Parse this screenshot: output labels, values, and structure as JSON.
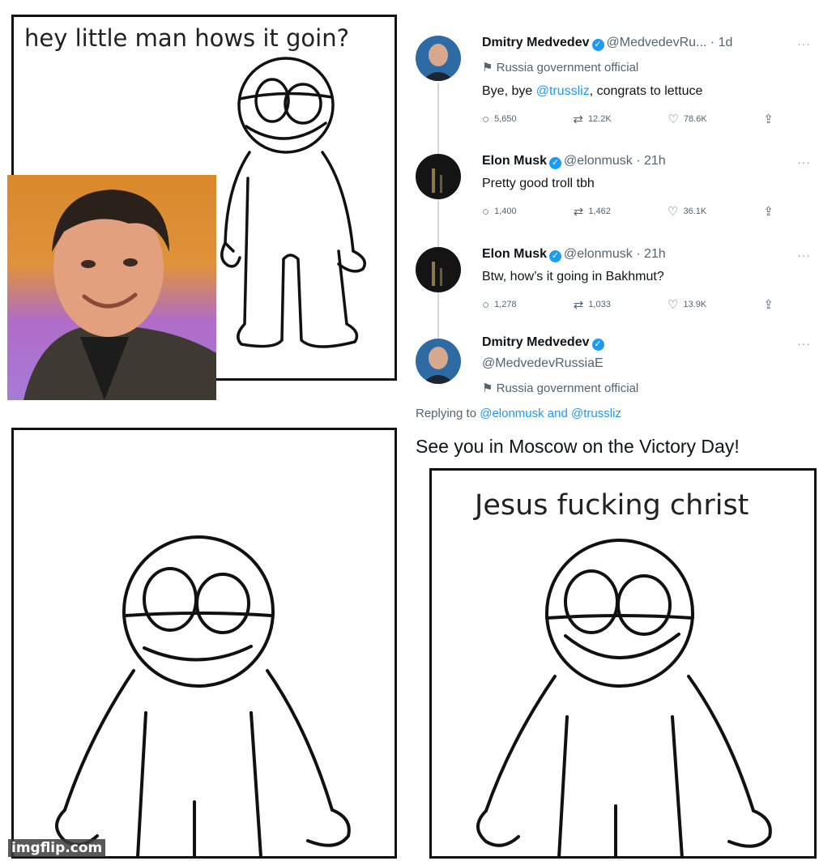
{
  "panels": {
    "top_left_caption": "hey little man hows it goin?",
    "bottom_right_caption": "Jesus fucking christ"
  },
  "tweets": [
    {
      "name": "Dmitry Medvedev",
      "handle": "@MedvedevRu...",
      "time": "· 1d",
      "gov_label": "Russia government official",
      "text_before": "Bye, bye ",
      "mention": "@trussliz",
      "text_after": ", congrats to lettuce",
      "replies": "5,650",
      "retweets": "12.2K",
      "likes": "78.6K"
    },
    {
      "name": "Elon Musk",
      "handle": "@elonmusk",
      "time": "· 21h",
      "text": "Pretty good troll tbh",
      "replies": "1,400",
      "retweets": "1,462",
      "likes": "36.1K"
    },
    {
      "name": "Elon Musk",
      "handle": "@elonmusk",
      "time": "· 21h",
      "text": "Btw, how’s it going in Bakhmut?",
      "replies": "1,278",
      "retweets": "1,033",
      "likes": "13.9K"
    },
    {
      "name": "Dmitry Medvedev",
      "handle": "@MedvedevRussiaE",
      "gov_label": "Russia government official",
      "replying_prefix": "Replying to ",
      "replying_to": "@elonmusk and @trussliz",
      "text": "See you in Moscow on the Victory Day!"
    }
  ],
  "icons": {
    "reply": "reply-icon",
    "retweet": "retweet-icon",
    "like": "heart-icon",
    "share": "share-icon",
    "verified": "verified-badge-icon",
    "gov_flag": "flag-icon",
    "more": "more-icon"
  },
  "colors": {
    "accent": "#1d9bf0",
    "muted": "#536471",
    "photo_bg_top": "#d9892b",
    "photo_bg_bottom": "#b06cc8"
  },
  "watermark": "imgflip.com"
}
